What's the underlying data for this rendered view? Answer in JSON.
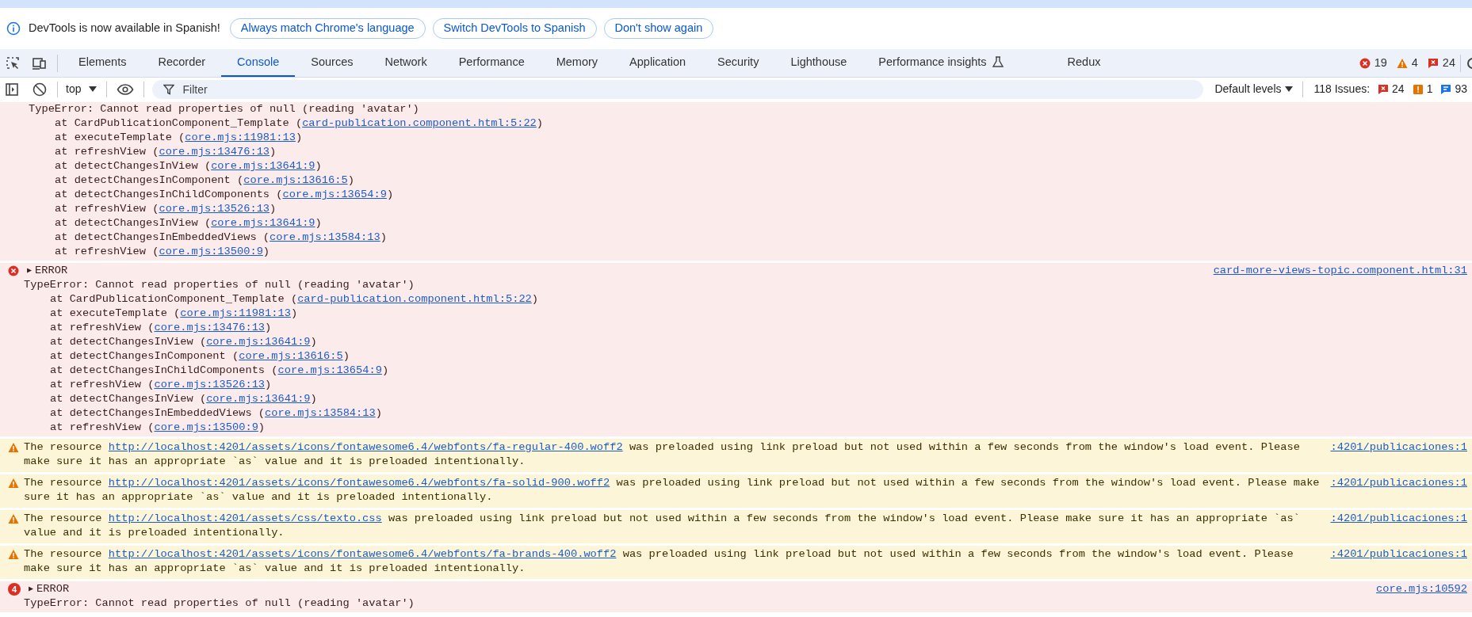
{
  "infobar": {
    "message": "DevTools is now available in Spanish!",
    "buttons": [
      "Always match Chrome's language",
      "Switch DevTools to Spanish",
      "Don't show again"
    ]
  },
  "tabs": [
    {
      "label": "Elements",
      "selected": false,
      "experimental": false
    },
    {
      "label": "Recorder",
      "selected": false,
      "experimental": false
    },
    {
      "label": "Console",
      "selected": true,
      "experimental": false
    },
    {
      "label": "Sources",
      "selected": false,
      "experimental": false
    },
    {
      "label": "Network",
      "selected": false,
      "experimental": false
    },
    {
      "label": "Performance",
      "selected": false,
      "experimental": false
    },
    {
      "label": "Memory",
      "selected": false,
      "experimental": false
    },
    {
      "label": "Application",
      "selected": false,
      "experimental": false
    },
    {
      "label": "Security",
      "selected": false,
      "experimental": false
    },
    {
      "label": "Lighthouse",
      "selected": false,
      "experimental": false
    },
    {
      "label": "Performance insights",
      "selected": false,
      "experimental": true
    },
    {
      "label": "Redux",
      "selected": false,
      "experimental": false
    }
  ],
  "counters": [
    {
      "kind": "error",
      "count": "19"
    },
    {
      "kind": "warning",
      "count": "4"
    },
    {
      "kind": "issue",
      "count": "24"
    }
  ],
  "toolbar": {
    "context": "top",
    "filter_placeholder": "Filter",
    "levels": "Default levels",
    "issues_label": "118 Issues:",
    "issue_counts": [
      {
        "kind": "error",
        "count": "24"
      },
      {
        "kind": "warning",
        "count": "1"
      },
      {
        "kind": "info",
        "count": "93"
      }
    ]
  },
  "messages": [
    {
      "kind": "error",
      "message": "TypeError: Cannot read properties of null (reading 'avatar')",
      "stack": [
        {
          "prefix": "at CardPublicationComponent_Template (",
          "link": "card-publication.component.html:5:22",
          "suffix": ")"
        },
        {
          "prefix": "at executeTemplate (",
          "link": "core.mjs:11981:13",
          "suffix": ")"
        },
        {
          "prefix": "at refreshView (",
          "link": "core.mjs:13476:13",
          "suffix": ")"
        },
        {
          "prefix": "at detectChangesInView (",
          "link": "core.mjs:13641:9",
          "suffix": ")"
        },
        {
          "prefix": "at detectChangesInComponent (",
          "link": "core.mjs:13616:5",
          "suffix": ")"
        },
        {
          "prefix": "at detectChangesInChildComponents (",
          "link": "core.mjs:13654:9",
          "suffix": ")"
        },
        {
          "prefix": "at refreshView (",
          "link": "core.mjs:13526:13",
          "suffix": ")"
        },
        {
          "prefix": "at detectChangesInView (",
          "link": "core.mjs:13641:9",
          "suffix": ")"
        },
        {
          "prefix": "at detectChangesInEmbeddedViews (",
          "link": "core.mjs:13584:13",
          "suffix": ")"
        },
        {
          "prefix": "at refreshView (",
          "link": "core.mjs:13500:9",
          "suffix": ")"
        }
      ]
    },
    {
      "kind": "error",
      "toggle": "▶",
      "label": "ERROR",
      "source": "card-more-views-topic.component.html:31",
      "message": "TypeError: Cannot read properties of null (reading 'avatar')",
      "stack": [
        {
          "prefix": "at CardPublicationComponent_Template (",
          "link": "card-publication.component.html:5:22",
          "suffix": ")"
        },
        {
          "prefix": "at executeTemplate (",
          "link": "core.mjs:11981:13",
          "suffix": ")"
        },
        {
          "prefix": "at refreshView (",
          "link": "core.mjs:13476:13",
          "suffix": ")"
        },
        {
          "prefix": "at detectChangesInView (",
          "link": "core.mjs:13641:9",
          "suffix": ")"
        },
        {
          "prefix": "at detectChangesInComponent (",
          "link": "core.mjs:13616:5",
          "suffix": ")"
        },
        {
          "prefix": "at detectChangesInChildComponents (",
          "link": "core.mjs:13654:9",
          "suffix": ")"
        },
        {
          "prefix": "at refreshView (",
          "link": "core.mjs:13526:13",
          "suffix": ")"
        },
        {
          "prefix": "at detectChangesInView (",
          "link": "core.mjs:13641:9",
          "suffix": ")"
        },
        {
          "prefix": "at detectChangesInEmbeddedViews (",
          "link": "core.mjs:13584:13",
          "suffix": ")"
        },
        {
          "prefix": "at refreshView (",
          "link": "core.mjs:13500:9",
          "suffix": ")"
        }
      ]
    },
    {
      "kind": "warning",
      "source": ":4201/publicaciones:1",
      "prefix": "The resource ",
      "url": "http://localhost:4201/assets/icons/fontawesome6.4/webfonts/fa-regular-400.woff2",
      "suffix": " was preloaded using link preload but not used within a few seconds from the window's load event. Please make sure it has an appropriate `as` value and it is preloaded intentionally."
    },
    {
      "kind": "warning",
      "source": ":4201/publicaciones:1",
      "prefix": "The resource ",
      "url": "http://localhost:4201/assets/icons/fontawesome6.4/webfonts/fa-solid-900.woff2",
      "suffix": " was preloaded using link preload but not used within a few seconds from the window's load event. Please make sure it has an appropriate `as` value and it is preloaded intentionally."
    },
    {
      "kind": "warning",
      "source": ":4201/publicaciones:1",
      "prefix": "The resource ",
      "url": "http://localhost:4201/assets/css/texto.css",
      "suffix": " was preloaded using link preload but not used within a few seconds from the window's load event. Please make sure it has an appropriate `as` value and it is preloaded intentionally."
    },
    {
      "kind": "warning",
      "source": ":4201/publicaciones:1",
      "prefix": "The resource ",
      "url": "http://localhost:4201/assets/icons/fontawesome6.4/webfonts/fa-brands-400.woff2",
      "suffix": " was preloaded using link preload but not used within a few seconds from the window's load event. Please make sure it has an appropriate `as` value and it is preloaded intentionally."
    },
    {
      "kind": "error",
      "repeat": "4",
      "toggle": "▶",
      "label": "ERROR",
      "source": "core.mjs:10592",
      "message": "TypeError: Cannot read properties of null (reading 'avatar')"
    }
  ]
}
